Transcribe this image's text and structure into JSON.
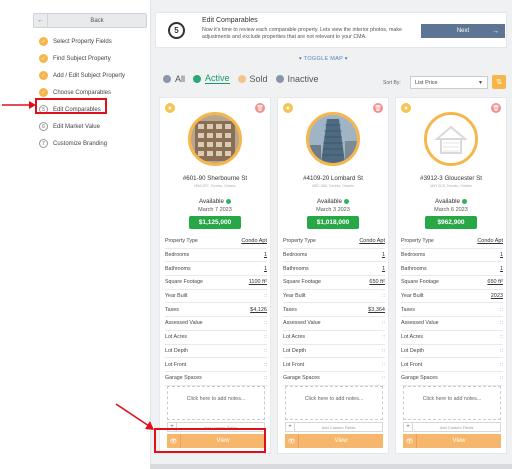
{
  "sidebar": {
    "back_label": "Back",
    "steps": [
      {
        "label": "Select Property Fields",
        "status": "done"
      },
      {
        "label": "Find Subject Property",
        "status": "done"
      },
      {
        "label": "Add / Edit Subject Property",
        "status": "done"
      },
      {
        "label": "Choose Comparables",
        "status": "done"
      },
      {
        "label": "Edit Comparables",
        "status": "current",
        "num": "5"
      },
      {
        "label": "Edit Market Value",
        "status": "todo",
        "num": "6"
      },
      {
        "label": "Customize Branding",
        "status": "todo",
        "num": "7"
      }
    ]
  },
  "header": {
    "step_number": "5",
    "title": "Edit Comparables",
    "description": "Now it's time to review each comparable property. Lets view the interior photos, make adjustments and exclude properties that are not relevant to your CMA.",
    "next_label": "Next"
  },
  "toggle_map": "TOGGLE MAP",
  "filters": [
    {
      "label": "All",
      "color": "#8a96a8"
    },
    {
      "label": "Active",
      "color": "#2aa879"
    },
    {
      "label": "Sold",
      "color": "#f5c48a"
    },
    {
      "label": "Inactive",
      "color": "#8a96a8"
    }
  ],
  "sort": {
    "label": "Sort By:",
    "value": "List Price"
  },
  "field_labels": [
    "Property Type",
    "Bedrooms",
    "Bathrooms",
    "Square Footage",
    "Year Built",
    "Taxes",
    "Assessed Value",
    "Lot Acres",
    "Lot Depth",
    "Lot Front",
    "Garage Spaces"
  ],
  "cards": [
    {
      "address": "#601-90 Sherbourne St",
      "sub": "M5A 2R7, Toronto, Ontario",
      "status": "Available",
      "date": "March 7 2023",
      "price": "$1,125,000",
      "values": [
        "Condo Apt",
        "1",
        "1",
        "1100 ft²",
        "::",
        "$4,126",
        "::",
        "::",
        "::",
        "::",
        "::"
      ],
      "notes": "Click here to add notes...",
      "custom": "Add Custom Fields",
      "view": "View"
    },
    {
      "address": "#4109-20 Lombard St",
      "sub": "M5C 0A8, Toronto, Ontario",
      "status": "Available",
      "date": "March 3 2023",
      "price": "$1,018,000",
      "values": [
        "Condo Apt",
        "1",
        "1",
        "650 ft²",
        "::",
        "$3,364",
        "::",
        "::",
        "::",
        "::",
        "::"
      ],
      "notes": "Click here to add notes...",
      "custom": "Add Custom Fields",
      "view": "View"
    },
    {
      "address": "#3912-3 Gloucester St",
      "sub": "M4Y 0C5, Toronto, Ontario",
      "status": "Available",
      "date": "March 6 2023",
      "price": "$962,900",
      "values": [
        "Condo Apt",
        "1",
        "1",
        "650 ft²",
        "2023",
        "::",
        "::",
        "::",
        "::",
        "::",
        "::"
      ],
      "notes": "Click here to add notes...",
      "custom": "Add Custom Fields",
      "view": "View"
    }
  ]
}
